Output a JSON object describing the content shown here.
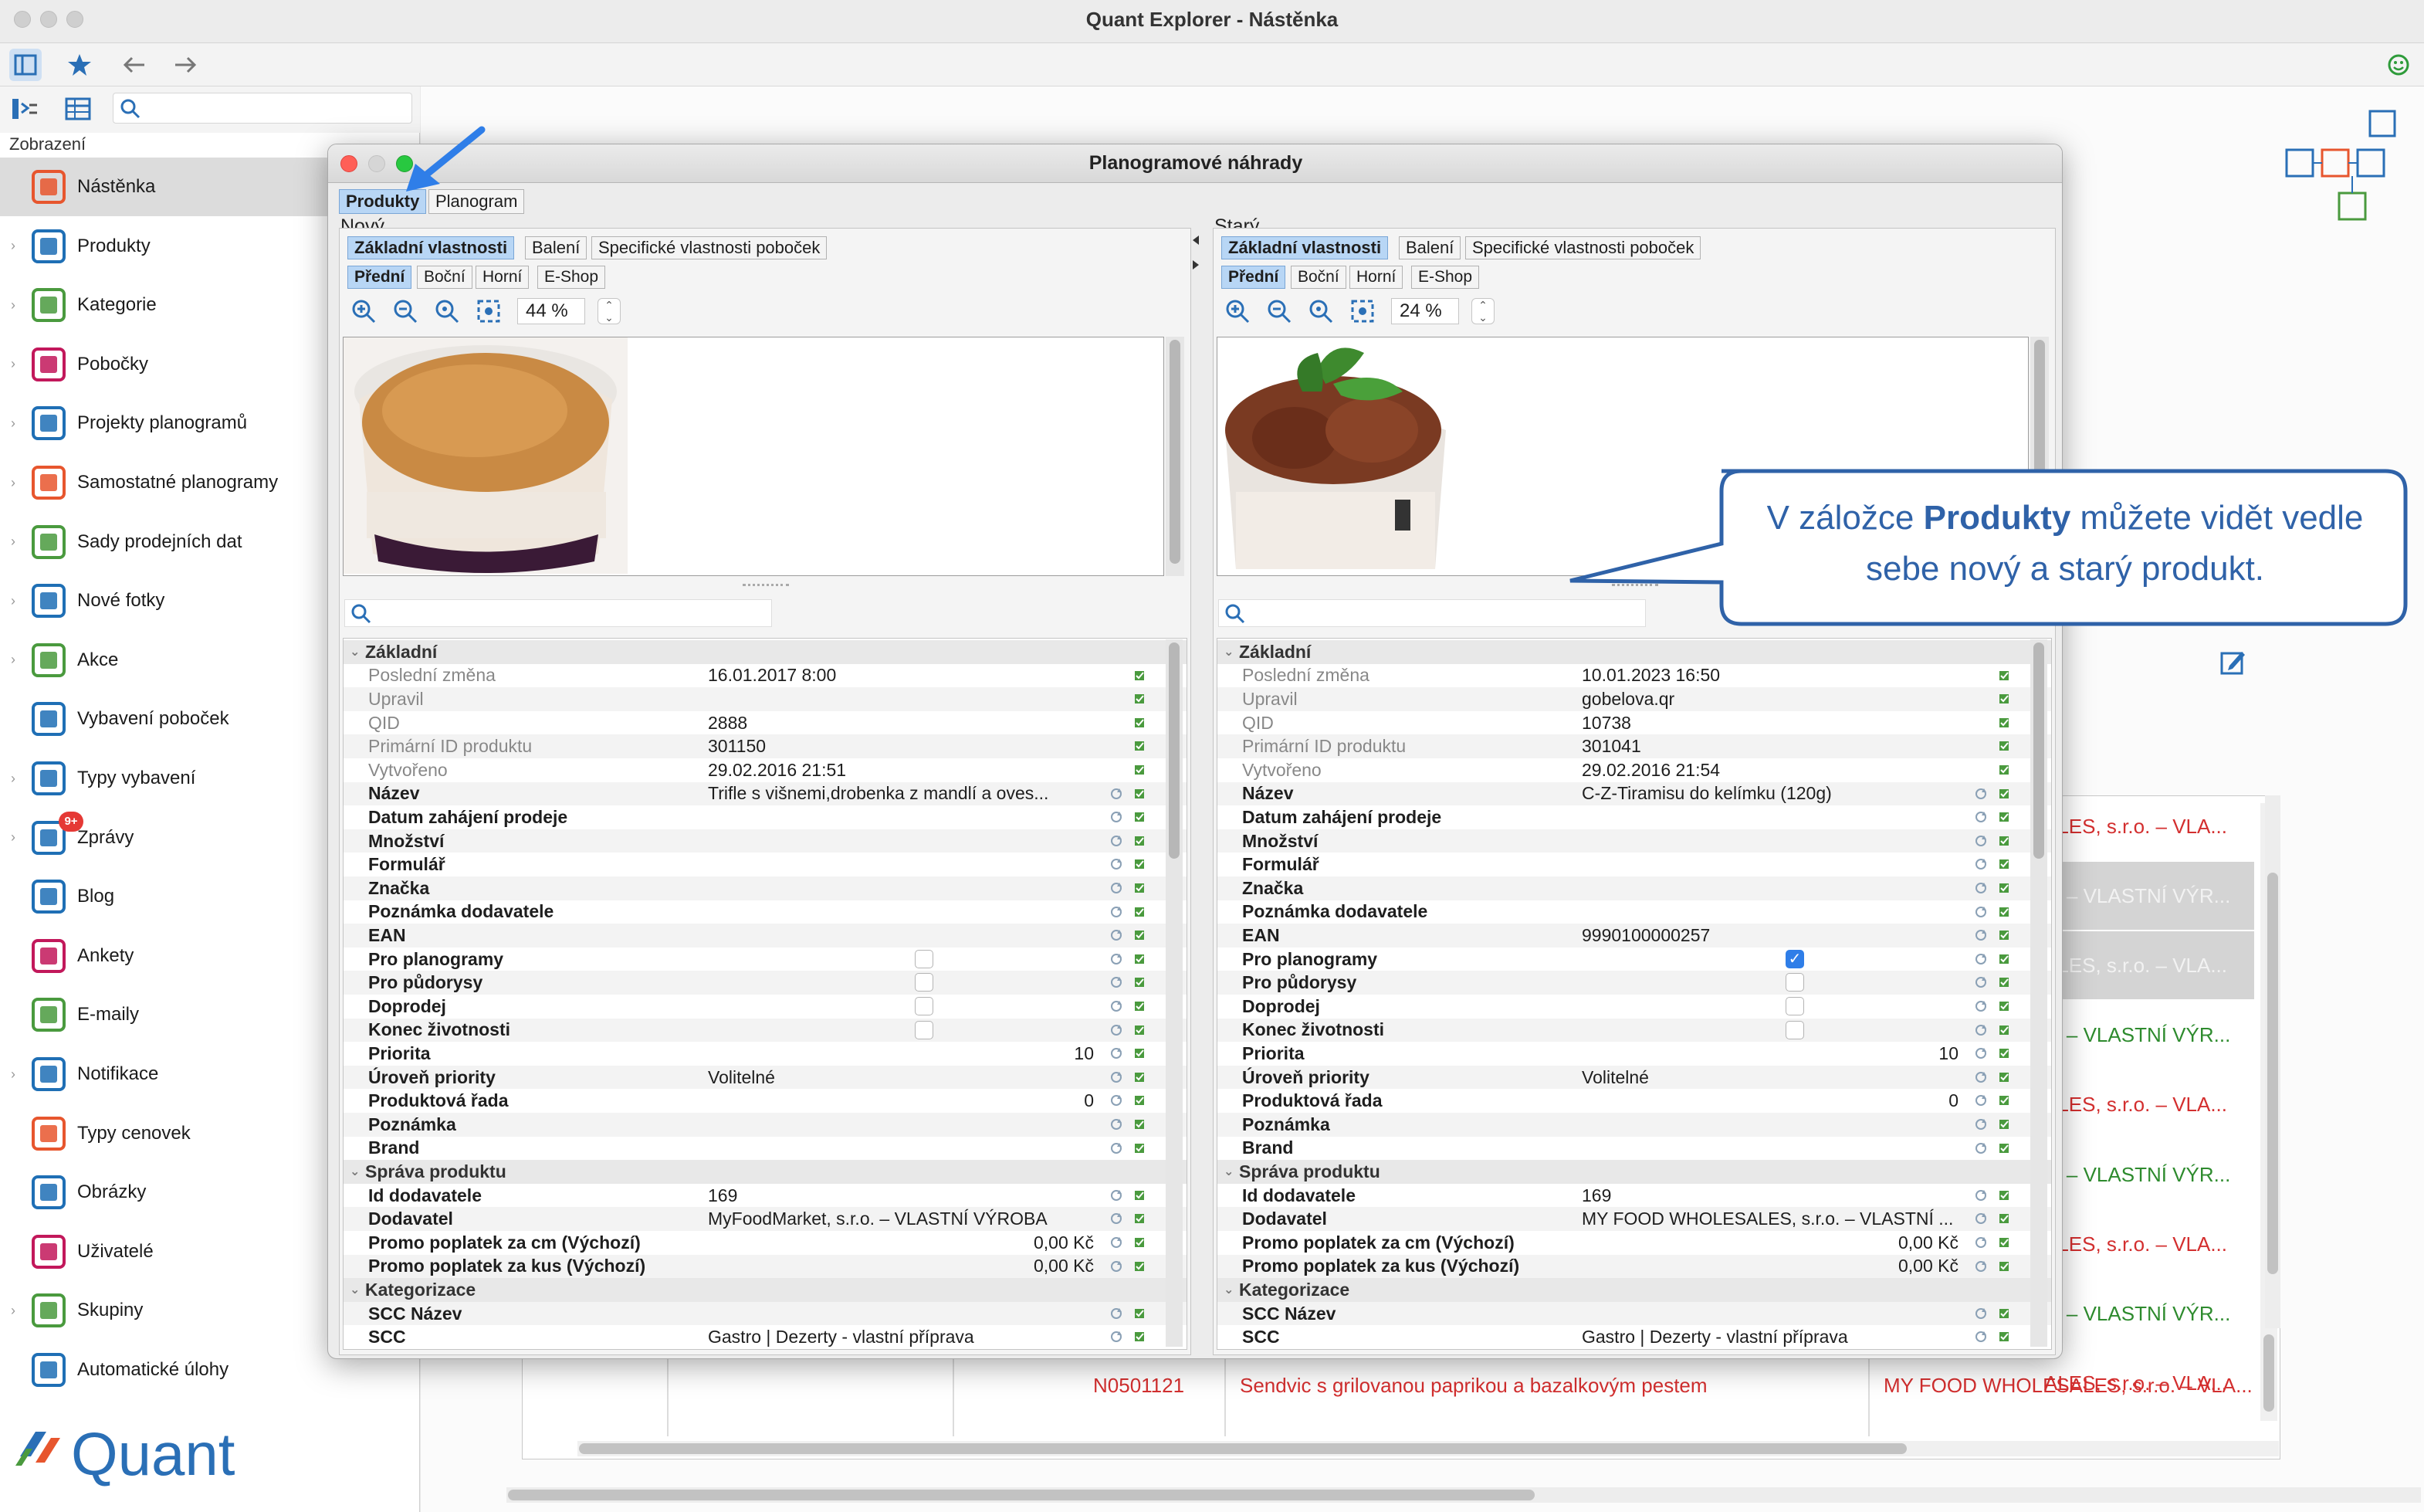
{
  "window": {
    "title": "Quant Explorer - Nástěnka"
  },
  "sidebar": {
    "caption": "Zobrazení",
    "search_placeholder": "",
    "items": [
      {
        "label": "Nástěnka",
        "icon": "dashboard-icon",
        "color": "#e7562e"
      },
      {
        "label": "Produkty",
        "icon": "product-icon",
        "color": "#1f6fb5"
      },
      {
        "label": "Kategorie",
        "icon": "category-tree-icon",
        "color": "#4a9a3e"
      },
      {
        "label": "Pobočky",
        "icon": "store-icon",
        "color": "#c2185b"
      },
      {
        "label": "Projekty planogramů",
        "icon": "planogram-project-icon",
        "color": "#1f6fb5"
      },
      {
        "label": "Samostatné planogramy",
        "icon": "planogram-icon",
        "color": "#e7562e"
      },
      {
        "label": "Sady prodejních dat",
        "icon": "sales-data-icon",
        "color": "#4a9a3e"
      },
      {
        "label": "Nové fotky",
        "icon": "camera-icon",
        "color": "#1f6fb5"
      },
      {
        "label": "Akce",
        "icon": "clock-icon",
        "color": "#4a9a3e"
      },
      {
        "label": "Vybavení poboček",
        "icon": "equipment-icon",
        "color": "#1f6fb5"
      },
      {
        "label": "Typy vybavení",
        "icon": "equipment-types-icon",
        "color": "#1f6fb5"
      },
      {
        "label": "Zprávy",
        "icon": "messages-icon",
        "color": "#1f6fb5",
        "badge": "9+"
      },
      {
        "label": "Blog",
        "icon": "blog-icon",
        "color": "#1f6fb5"
      },
      {
        "label": "Ankety",
        "icon": "survey-icon",
        "color": "#c2185b"
      },
      {
        "label": "E-maily",
        "icon": "mail-icon",
        "color": "#4a9a3e"
      },
      {
        "label": "Notifikace",
        "icon": "bell-icon",
        "color": "#1f6fb5"
      },
      {
        "label": "Typy cenovek",
        "icon": "price-tag-icon",
        "color": "#e7562e"
      },
      {
        "label": "Obrázky",
        "icon": "image-icon",
        "color": "#1f6fb5"
      },
      {
        "label": "Uživatelé",
        "icon": "user-icon",
        "color": "#c2185b"
      },
      {
        "label": "Skupiny",
        "icon": "group-icon",
        "color": "#4a9a3e"
      },
      {
        "label": "Automatické úlohy",
        "icon": "automation-icon",
        "color": "#1f6fb5"
      }
    ],
    "logo_text": "Quant"
  },
  "background_table": {
    "rows": [
      {
        "right": "ALES, s.r.o. – VLA...",
        "color": "#d32f2f",
        "gray": false
      },
      {
        "right": "o. – VLASTNÍ VÝR...",
        "color": "#f2f2f2",
        "gray": true
      },
      {
        "right": "ALES, s.r.o. – VLA...",
        "color": "#f2f2f2",
        "gray": true
      },
      {
        "right": "o. – VLASTNÍ VÝR...",
        "color": "#2e8b2e",
        "gray": false
      },
      {
        "right": "ALES, s.r.o. – VLA...",
        "color": "#d32f2f",
        "gray": false
      },
      {
        "right": "o. – VLASTNÍ VÝR...",
        "color": "#2e8b2e",
        "gray": false
      },
      {
        "right": "ALES, s.r.o. – VLA...",
        "color": "#d32f2f",
        "gray": false
      },
      {
        "right": "o. – VLASTNÍ VÝR...",
        "color": "#2e8b2e",
        "gray": false
      },
      {
        "right": "ALES, s.r.o. – VLA...",
        "color": "#d32f2f",
        "gray": false
      }
    ],
    "last_row": {
      "code": "N0501121",
      "name": "Sendvic s grilovanou paprikou a bazalkovým pestem",
      "supplier": "MY FOOD WHOLESALES, s.r.o. – VLA...",
      "color": "#d32f2f"
    }
  },
  "dialog": {
    "title": "Planogramové náhrady",
    "tabs": [
      "Produkty",
      "Planogram"
    ],
    "active_tab": "Produkty",
    "panes": [
      {
        "caption": "Nový",
        "subtabs": [
          "Základní vlastnosti",
          "Balení",
          "Specifické vlastnosti poboček"
        ],
        "view_tabs": [
          "Přední",
          "Boční",
          "Horní",
          "E-Shop"
        ],
        "zoom": "44 %",
        "image_alt": "trifle-crumble-dessert-photo",
        "rows": [
          {
            "type": "group",
            "label": "Základní"
          },
          {
            "label": "Poslední změna",
            "value": "16.01.2017 8:00",
            "grey": true
          },
          {
            "label": "Upravil",
            "value": "",
            "grey": true
          },
          {
            "label": "QID",
            "value": "2888",
            "grey": true
          },
          {
            "label": "Primární ID produktu",
            "value": "301150",
            "grey": true
          },
          {
            "label": "Vytvořeno",
            "value": "29.02.2016 21:51",
            "grey": true
          },
          {
            "label": "Název",
            "value": "Trifle s višnemi,drobenka z mandlí a oves..."
          },
          {
            "label": "Datum zahájení prodeje",
            "value": ""
          },
          {
            "label": "Množství",
            "value": ""
          },
          {
            "label": "Formulář",
            "value": ""
          },
          {
            "label": "Značka",
            "value": ""
          },
          {
            "label": "Poznámka dodavatele",
            "value": ""
          },
          {
            "label": "EAN",
            "value": ""
          },
          {
            "label": "Pro planogramy",
            "check": false
          },
          {
            "label": "Pro půdorysy",
            "check": false
          },
          {
            "label": "Doprodej",
            "check": false
          },
          {
            "label": "Konec životnosti",
            "check": false
          },
          {
            "label": "Priorita",
            "value": "10",
            "right": true
          },
          {
            "label": "Úroveň priority",
            "value": "Volitelné"
          },
          {
            "label": "Produktová řada",
            "value": "0",
            "right": true
          },
          {
            "label": "Poznámka",
            "value": ""
          },
          {
            "label": "Brand",
            "value": ""
          },
          {
            "type": "group",
            "label": "Správa produktu"
          },
          {
            "label": "Id dodavatele",
            "value": "169"
          },
          {
            "label": "Dodavatel",
            "value": "MyFoodMarket, s.r.o. – VLASTNÍ VÝROBA"
          },
          {
            "label": "Promo poplatek za cm (Výchozí)",
            "value": "0,00 Kč",
            "right": true
          },
          {
            "label": "Promo poplatek za kus (Výchozí)",
            "value": "0,00 Kč",
            "right": true
          },
          {
            "type": "group",
            "label": "Kategorizace"
          },
          {
            "label": "SCC Název",
            "value": ""
          },
          {
            "label": "SCC",
            "value": "Gastro | Dezerty - vlastní příprava"
          }
        ]
      },
      {
        "caption": "Starý",
        "subtabs": [
          "Základní vlastnosti",
          "Balení",
          "Specifické vlastnosti poboček"
        ],
        "view_tabs": [
          "Přední",
          "Boční",
          "Horní",
          "E-Shop"
        ],
        "zoom": "24 %",
        "image_alt": "tiramisu-cup-photo",
        "rows": [
          {
            "type": "group",
            "label": "Základní"
          },
          {
            "label": "Poslední změna",
            "value": "10.01.2023 16:50",
            "grey": true
          },
          {
            "label": "Upravil",
            "value": "gobelova.qr",
            "grey": true
          },
          {
            "label": "QID",
            "value": "10738",
            "grey": true
          },
          {
            "label": "Primární ID produktu",
            "value": "301041",
            "grey": true
          },
          {
            "label": "Vytvořeno",
            "value": "29.02.2016 21:54",
            "grey": true
          },
          {
            "label": "Název",
            "value": "C-Z-Tiramisu do kelímku (120g)"
          },
          {
            "label": "Datum zahájení prodeje",
            "value": ""
          },
          {
            "label": "Množství",
            "value": ""
          },
          {
            "label": "Formulář",
            "value": ""
          },
          {
            "label": "Značka",
            "value": ""
          },
          {
            "label": "Poznámka dodavatele",
            "value": ""
          },
          {
            "label": "EAN",
            "value": "9990100000257"
          },
          {
            "label": "Pro planogramy",
            "check": true
          },
          {
            "label": "Pro půdorysy",
            "check": false
          },
          {
            "label": "Doprodej",
            "check": false
          },
          {
            "label": "Konec životnosti",
            "check": false
          },
          {
            "label": "Priorita",
            "value": "10",
            "right": true
          },
          {
            "label": "Úroveň priority",
            "value": "Volitelné"
          },
          {
            "label": "Produktová řada",
            "value": "0",
            "right": true
          },
          {
            "label": "Poznámka",
            "value": ""
          },
          {
            "label": "Brand",
            "value": ""
          },
          {
            "type": "group",
            "label": "Správa produktu"
          },
          {
            "label": "Id dodavatele",
            "value": "169"
          },
          {
            "label": "Dodavatel",
            "value": "MY FOOD WHOLESALES, s.r.o. – VLASTNÍ ..."
          },
          {
            "label": "Promo poplatek za cm (Výchozí)",
            "value": "0,00 Kč",
            "right": true
          },
          {
            "label": "Promo poplatek za kus (Výchozí)",
            "value": "0,00 Kč",
            "right": true
          },
          {
            "type": "group",
            "label": "Kategorizace"
          },
          {
            "label": "SCC Název",
            "value": ""
          },
          {
            "label": "SCC",
            "value": "Gastro | Dezerty - vlastní příprava"
          }
        ]
      }
    ]
  },
  "callout": {
    "before": "V záložce ",
    "bold": "Produkty",
    "after": " můžete vidět vedle sebe nový a starý produkt."
  },
  "colors": {
    "accent": "#2f7ee8",
    "callout_border": "#2f62a8",
    "active_tab": "#b8d6f5"
  }
}
